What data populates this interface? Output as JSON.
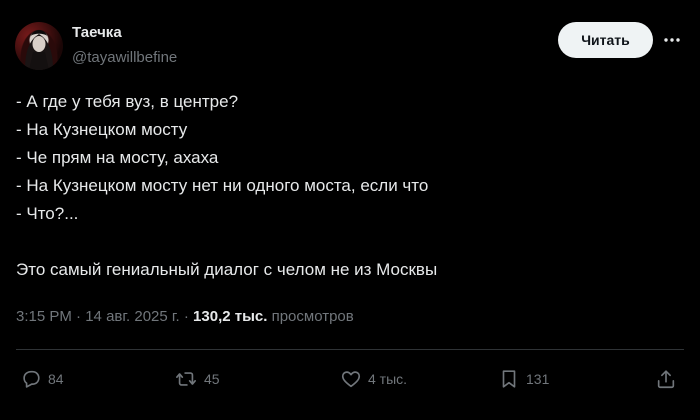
{
  "author": {
    "display_name": "Таечка",
    "handle": "@tayawillbefine"
  },
  "header": {
    "follow_label": "Читать",
    "more_icon": "more-dots-icon"
  },
  "tweet": {
    "lines": [
      "- А где у тебя вуз, в центре?",
      "- На Кузнецком мосту",
      "- Че прям на мосту, ахаха",
      "- На Кузнецком мосту нет ни одного моста, если что",
      "- Что?...",
      "",
      "Это самый гениальный диалог с челом не из Москвы"
    ]
  },
  "meta": {
    "time": "3:15 PM",
    "sep1": " · ",
    "date": "14 авг. 2025 г.",
    "sep2": " · ",
    "views_count": "130,2 тыс.",
    "views_label": " просмотров"
  },
  "actions": {
    "replies": "84",
    "reposts": "45",
    "likes": "4 тыс.",
    "bookmarks": "131"
  },
  "colors": {
    "background": "#000000",
    "text": "#e7e9ea",
    "muted": "#71767b",
    "divider": "#2f3336",
    "button_bg": "#eff3f4"
  }
}
